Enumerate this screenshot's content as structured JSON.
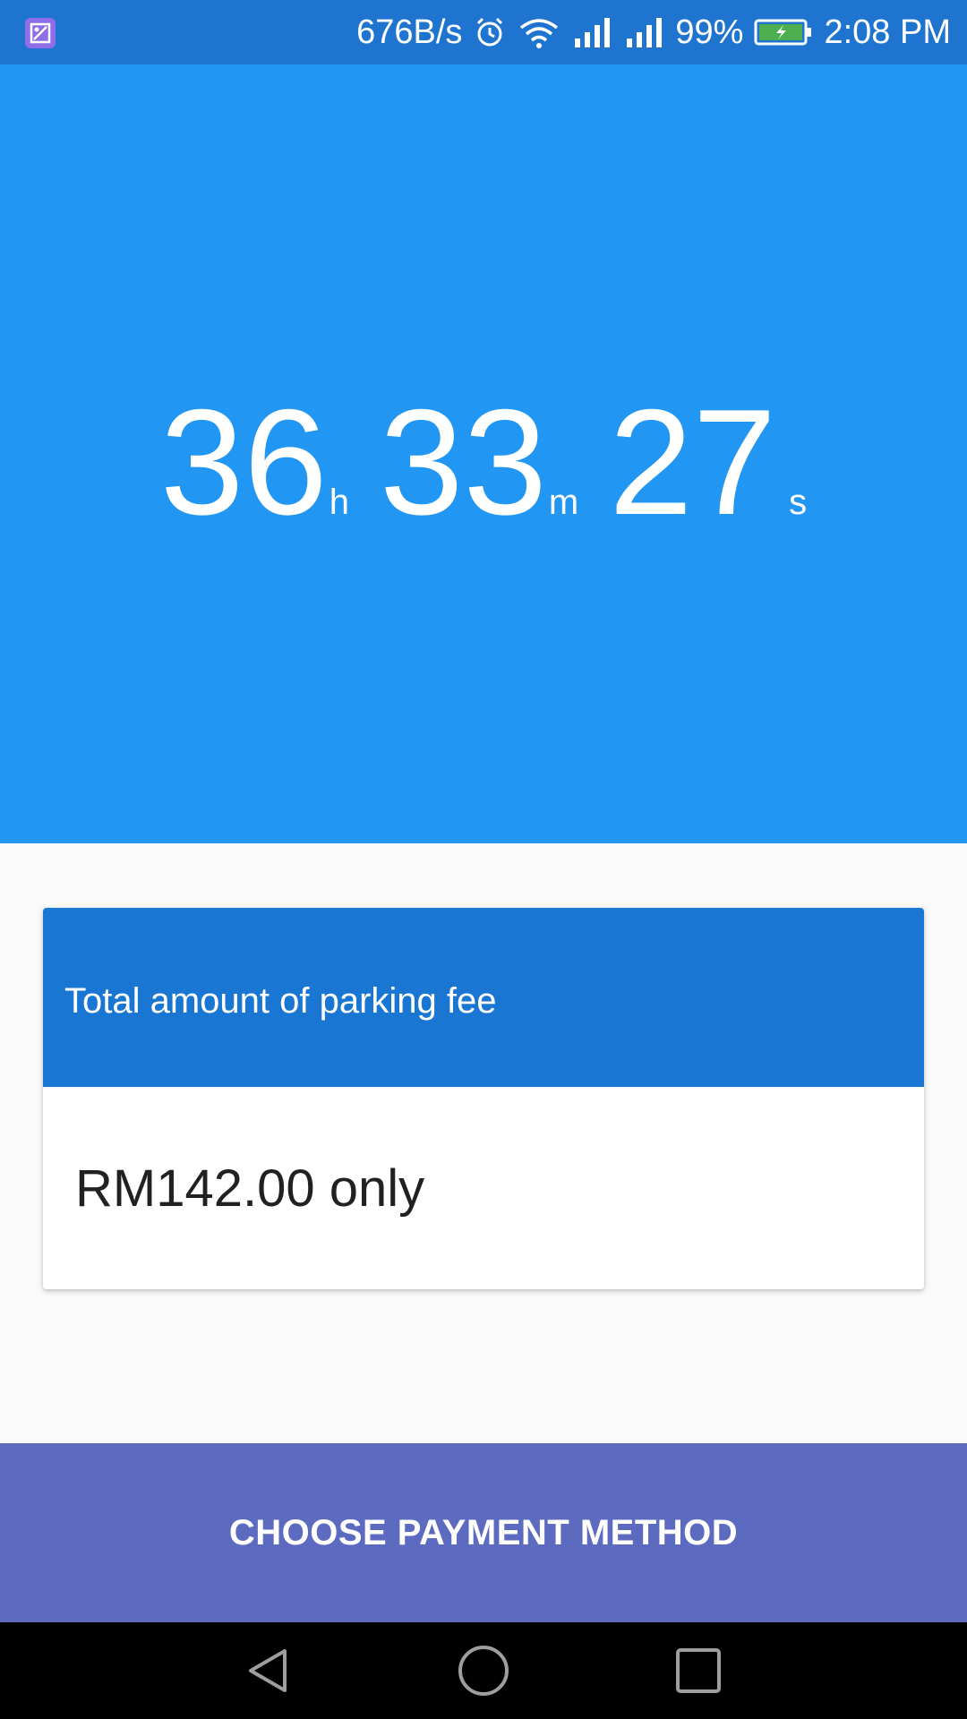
{
  "status_bar": {
    "net_speed": "676B/s",
    "battery_percent": "99%",
    "time": "2:08 PM",
    "icons": [
      "gallery-icon",
      "alarm-icon",
      "wifi-icon",
      "signal-icon",
      "signal-icon",
      "battery-charging-icon"
    ]
  },
  "timer": {
    "hours": "36",
    "hours_unit": "h",
    "minutes": "33",
    "minutes_unit": "m",
    "seconds": "27",
    "seconds_unit": "s"
  },
  "fee_card": {
    "title": "Total amount of parking fee",
    "amount": "RM142.00 only"
  },
  "actions": {
    "choose_payment_label": "CHOOSE PAYMENT METHOD"
  },
  "navigation": {
    "buttons": [
      "back-icon",
      "home-icon",
      "recents-icon"
    ]
  },
  "colors": {
    "status_bar": "#1e74cf",
    "timer_background": "#2196f3",
    "card_header": "#1976d2",
    "button": "#5c6bc0",
    "battery": "#4caf50"
  }
}
